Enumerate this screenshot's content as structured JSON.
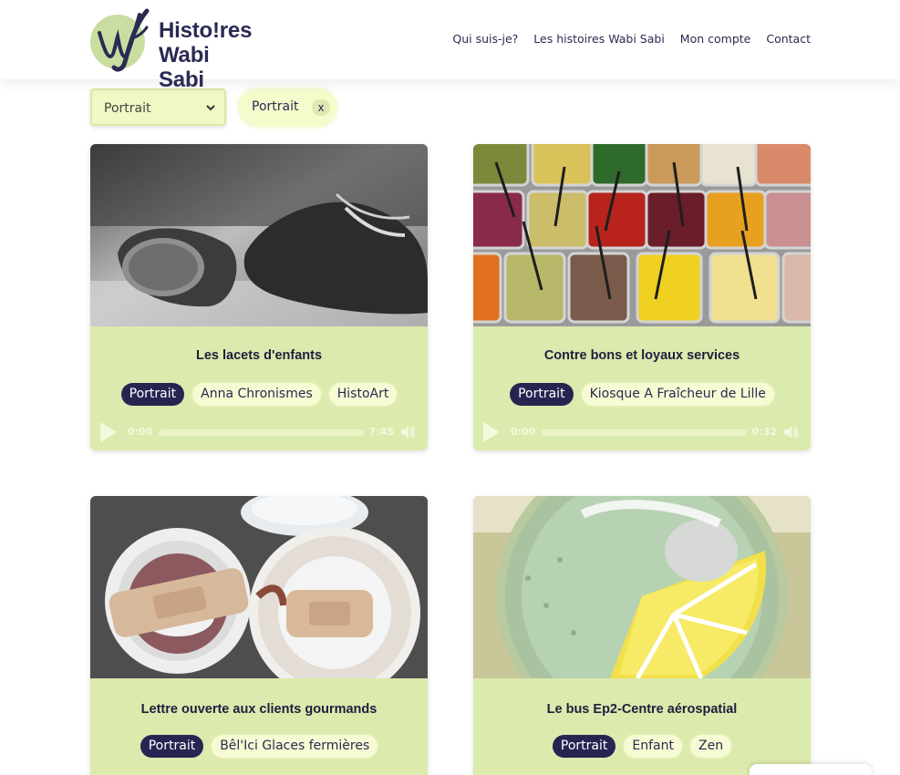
{
  "brand": {
    "logo_line1": "Histo!res",
    "logo_line2": "Wabi Sabi",
    "colors": {
      "navy": "#252552",
      "card_bg": "#dbeaad",
      "chip_bg": "#f7fbd3",
      "logo_circle": "#c9dda1"
    }
  },
  "nav": {
    "items": [
      "Qui suis-je?",
      "Les histoires Wabi Sabi",
      "Mon compte",
      "Contact"
    ]
  },
  "filter": {
    "select_value": "Portrait",
    "active_chip": "Portrait",
    "remove_label": "x"
  },
  "cards": [
    {
      "title": "Les lacets d'enfants",
      "tags": [
        "Portrait",
        "Anna Chronismes",
        "HistoArt"
      ],
      "audio": {
        "current": "0:00",
        "duration": "7:45",
        "icons": [
          "play-icon",
          "volume-icon"
        ]
      },
      "image": "black-and-white photo of children's shoes"
    },
    {
      "title": "Contre bons et loyaux services",
      "tags": [
        "Portrait",
        "Kiosque A Fraîcheur de Lille"
      ],
      "audio": {
        "current": "0:00",
        "duration": "0:32",
        "icons": [
          "play-icon",
          "volume-icon"
        ]
      },
      "image": "salad bar with trays of vegetables"
    },
    {
      "title": "Lettre ouverte aux clients gourmands",
      "tags": [
        "Portrait",
        "Bêl'Ici Glaces fermières"
      ],
      "image": "bandages on ice cream containers"
    },
    {
      "title": "Le bus Ep2-Centre aérospatial",
      "tags": [
        "Portrait",
        "Enfant",
        "Zen"
      ],
      "image": "illustrated drink with lemon slice"
    }
  ]
}
